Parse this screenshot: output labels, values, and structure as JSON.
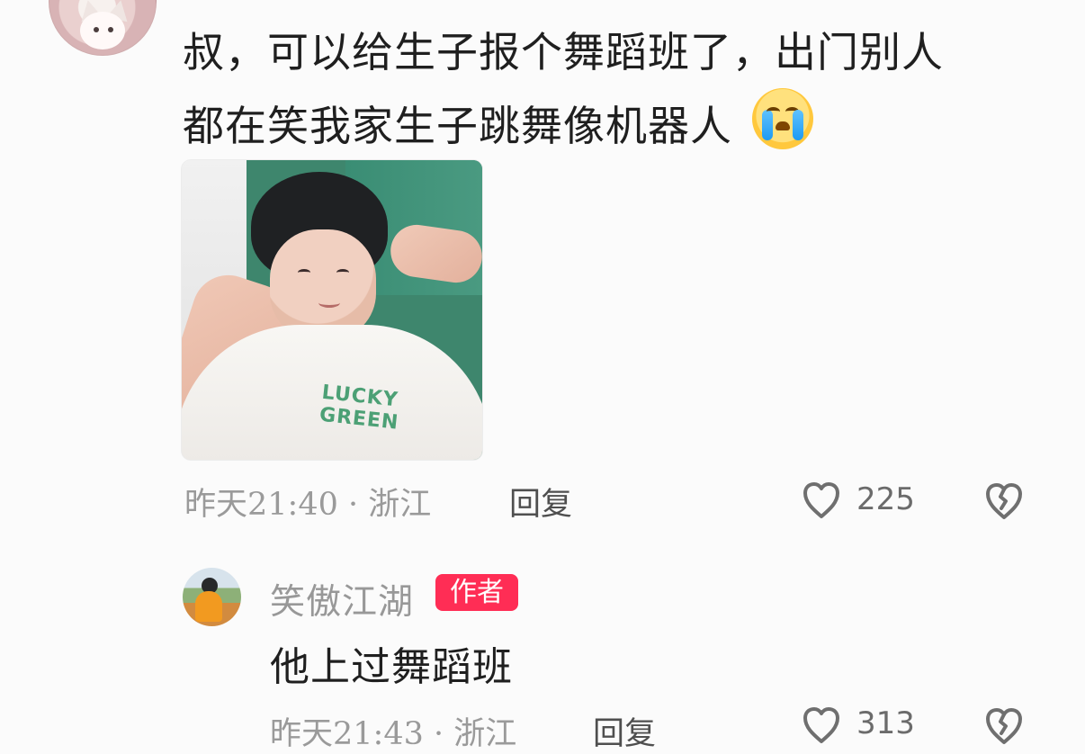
{
  "comment": {
    "text_line_1": "叔，可以给生子报个舞蹈班了，出门别人",
    "text_line_2": "都在笑我家生子跳舞像机器人",
    "emoji": "crying-face-icon",
    "photo_caption": "LUCKY GREEN",
    "time_location": "昨天21:40 · 浙江",
    "reply_label": "回复",
    "likes": "225"
  },
  "reply": {
    "name": "笑傲江湖",
    "badge": "作者",
    "text": "他上过舞蹈班",
    "time_location": "昨天21:43 · 浙江",
    "reply_label": "回复",
    "likes": "313"
  },
  "colors": {
    "background": "#fbfbfb",
    "badge": "#ff2d55",
    "meta_text": "#9a9a9a",
    "main_text": "#1f1f1f"
  }
}
